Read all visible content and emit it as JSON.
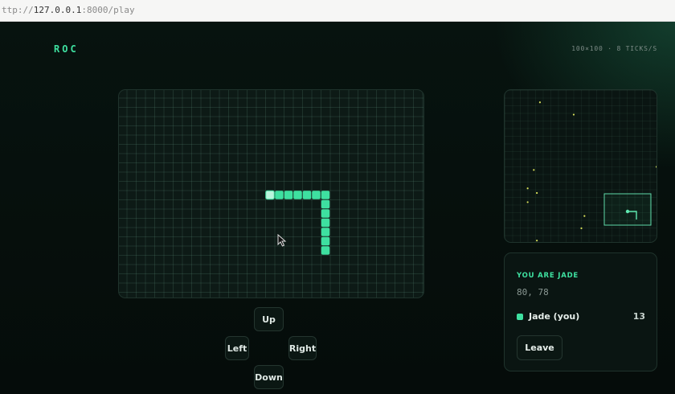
{
  "browser": {
    "url_prefix": "ttp://",
    "url_host": "127.0.0.1",
    "url_rest": ":8000/play"
  },
  "header": {
    "logo": "ROC",
    "world_info": "100×100 · 8 TICKS/S"
  },
  "colors": {
    "accent": "#3ee0a0",
    "snake_head": "#b9f5dc",
    "food": "#d8e05a"
  },
  "board": {
    "snake": [
      [
        16,
        11
      ],
      [
        17,
        11
      ],
      [
        18,
        11
      ],
      [
        19,
        11
      ],
      [
        20,
        11
      ],
      [
        21,
        11
      ],
      [
        22,
        11
      ],
      [
        22,
        12
      ],
      [
        22,
        13
      ],
      [
        22,
        14
      ],
      [
        22,
        15
      ],
      [
        22,
        16
      ],
      [
        22,
        17
      ]
    ]
  },
  "controls": {
    "up": "Up",
    "left": "Left",
    "right": "Right",
    "down": "Down"
  },
  "minimap": {
    "food": [
      [
        0.45,
        0.16
      ],
      [
        0.23,
        0.08
      ],
      [
        0.19,
        0.52
      ],
      [
        0.15,
        0.64
      ],
      [
        0.21,
        0.67
      ],
      [
        0.15,
        0.73
      ],
      [
        0.52,
        0.82
      ],
      [
        0.5,
        0.9
      ],
      [
        0.21,
        1.02
      ],
      [
        0.99,
        0.5
      ]
    ]
  },
  "status": {
    "you_are": "YOU ARE JADE",
    "coords": "80, 78",
    "players": [
      {
        "name": "Jade (you)",
        "score": "13"
      }
    ],
    "leave_label": "Leave"
  }
}
